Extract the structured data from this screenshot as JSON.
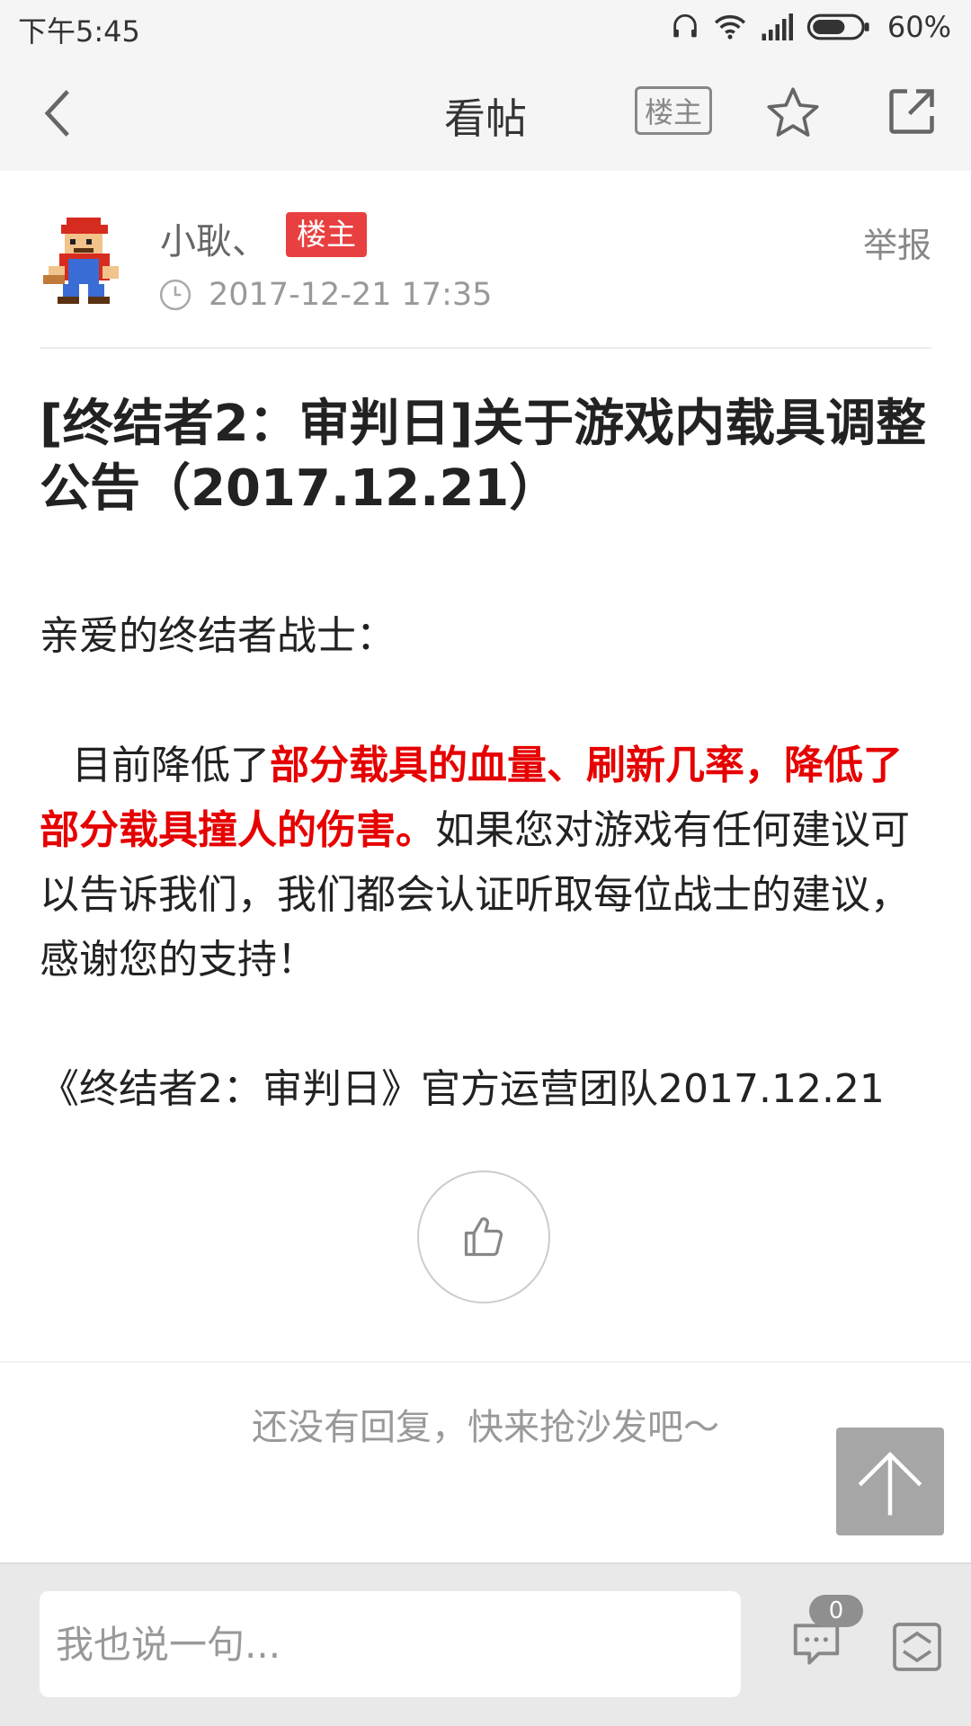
{
  "status_bar": {
    "time": "下午5:45",
    "battery": "60%",
    "icons": [
      "headphones-icon",
      "wifi-icon",
      "signal-icon",
      "battery-icon"
    ]
  },
  "nav": {
    "title": "看帖",
    "owner_only_label": "楼主",
    "icons": [
      "back-arrow-icon",
      "star-icon",
      "share-icon"
    ]
  },
  "post": {
    "author": "小耿、",
    "owner_badge": "楼主",
    "report": "举报",
    "time": "2017-12-21 17:35",
    "title": "[终结者2：审判日]关于游戏内载具调整公告（2017.12.21）",
    "greeting": "亲爱的终结者战士：",
    "body_prefix": "目前降低了",
    "body_highlight": "部分载具的血量、刷新几率，降低了部分载具撞人的伤害。",
    "body_suffix": "如果您对游戏有任何建议可以告诉我们，我们都会认证听取每位战士的建议，感谢您的支持！",
    "signature": "《终结者2：审判日》官方运营团队2017.12.21"
  },
  "replies": {
    "empty_text": "还没有回复，快来抢沙发吧～",
    "count": "0"
  },
  "bottom_bar": {
    "placeholder": "我也说一句..."
  },
  "colors": {
    "highlight": "#e60000",
    "badge": "#e84040",
    "bar_bg": "#f5f5f5"
  }
}
